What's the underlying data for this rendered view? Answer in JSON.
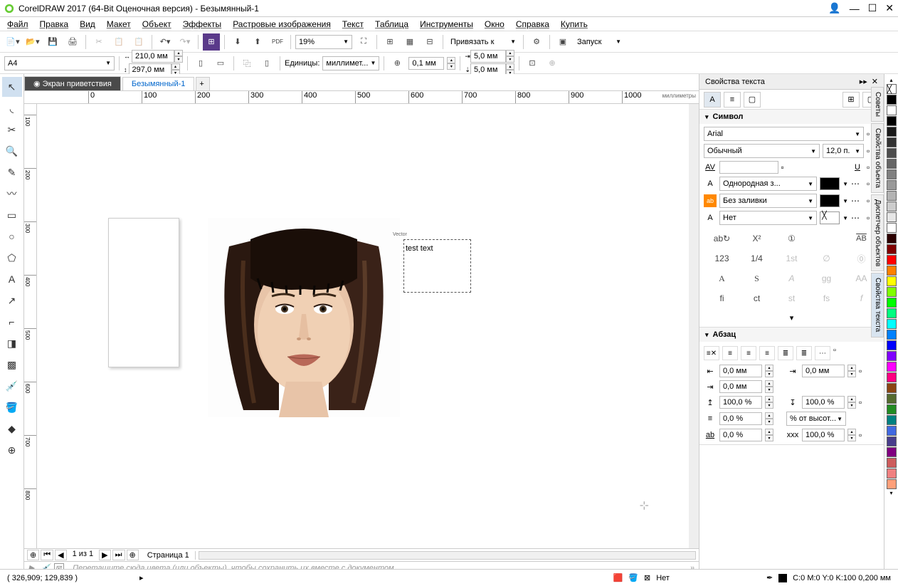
{
  "window": {
    "title": "CorelDRAW 2017 (64-Bit Оценочная версия) - Безымянный-1"
  },
  "menu": [
    "Файл",
    "Правка",
    "Вид",
    "Макет",
    "Объект",
    "Эффекты",
    "Растровые изображения",
    "Текст",
    "Таблица",
    "Инструменты",
    "Окно",
    "Справка",
    "Купить"
  ],
  "toolbar": {
    "zoom": "19%",
    "snap_label": "Привязать к",
    "launch_label": "Запуск"
  },
  "props_bar": {
    "page_size": "A4",
    "width": "210,0 мм",
    "height": "297,0 мм",
    "units_label": "Единицы:",
    "units_value": "миллимет...",
    "nudge": "0,1 мм",
    "dup_x": "5,0 мм",
    "dup_y": "5,0 мм"
  },
  "doc_tabs": {
    "welcome": "Экран приветствия",
    "active": "Безымянный-1"
  },
  "ruler": {
    "ticks_h": [
      "0",
      "100",
      "200",
      "300",
      "400",
      "500",
      "600",
      "700",
      "800",
      "900",
      "1000"
    ],
    "ticks_v": [
      "100",
      "200",
      "300",
      "400",
      "500",
      "600",
      "700",
      "800"
    ],
    "units": "миллиметры"
  },
  "canvas": {
    "vector_label": "Vector",
    "text_content": "test text"
  },
  "page_nav": {
    "indicator": "1  из  1",
    "page_tab": "Страница 1"
  },
  "color_tray_hint": "Перетащите сюда цвета (или объекты), чтобы сохранить их вместе с документом",
  "text_props": {
    "title": "Свойства текста",
    "section_symbol": "Символ",
    "font": "Arial",
    "style": "Обычный",
    "size": "12,0 п.",
    "fill_type": "Однородная з...",
    "bg_fill": "Без заливки",
    "outline": "Нет",
    "section_para": "Абзац",
    "indent_left": "0,0 мм",
    "indent_right": "0,0 мм",
    "indent_first": "0,0 мм",
    "before": "100,0 %",
    "after": "100,0 %",
    "line": "0,0 %",
    "line_unit": "% от высот...",
    "char_sp": "0,0 %",
    "word_sp": "100,0 %"
  },
  "side_dockers": [
    "Советы",
    "Свойства объекта",
    "Диспетчер объектов",
    "Свойства текста"
  ],
  "palette": [
    "#ffffff",
    "#000000",
    "#191919",
    "#333333",
    "#4d4d4d",
    "#666666",
    "#808080",
    "#999999",
    "#b3b3b3",
    "#cccccc",
    "#e6e6e6",
    "#ffffff",
    "#2b0000",
    "#800000",
    "#ff0000",
    "#ff8000",
    "#ffff00",
    "#80ff00",
    "#00ff00",
    "#00ff80",
    "#00ffff",
    "#0080ff",
    "#0000ff",
    "#8000ff",
    "#ff00ff",
    "#ff0080",
    "#8b4513",
    "#556b2f",
    "#228b22",
    "#008080",
    "#4169e1",
    "#483d8b",
    "#800080",
    "#cd5c5c",
    "#f08080",
    "#ffa07a"
  ],
  "statusbar": {
    "coords": "( 326,909; 129,839 )",
    "fill_none": "Нет",
    "cmyk": "C:0 M:0 Y:0 K:100  0,200 мм"
  }
}
